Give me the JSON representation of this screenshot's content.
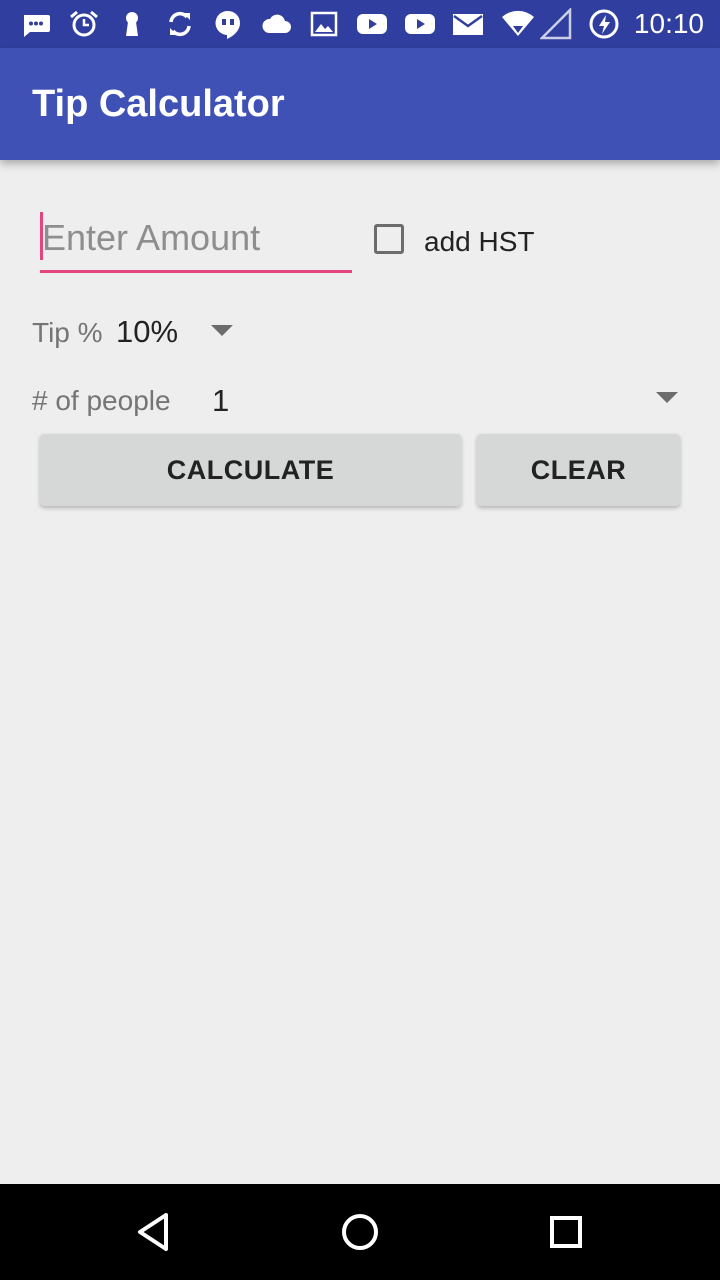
{
  "status_bar": {
    "time": "10:10",
    "icons": [
      "chat-bubble-icon",
      "alarm-clock-icon",
      "keyhole-icon",
      "sync-icon",
      "hangouts-icon",
      "cloud-icon",
      "image-icon",
      "youtube-icon",
      "youtube-icon",
      "mail-icon",
      "wifi-icon",
      "signal-icon",
      "battery-charging-icon"
    ]
  },
  "app_bar": {
    "title": "Tip Calculator"
  },
  "amount_input": {
    "value": "",
    "placeholder": "Enter Amount"
  },
  "hst_checkbox": {
    "label": "add HST",
    "checked": false
  },
  "tip": {
    "label": "Tip %",
    "selected": "10%"
  },
  "people": {
    "label": "# of people",
    "selected": "1"
  },
  "buttons": {
    "calculate": "CALCULATE",
    "clear": "CLEAR"
  },
  "colors": {
    "status_bar": "#303f9f",
    "app_bar": "#3f51b5",
    "accent": "#e5457e",
    "background": "#eeeeee",
    "button": "#d6d7d7"
  },
  "nav_bar": {
    "icons": [
      "back-icon",
      "home-icon",
      "recents-icon"
    ]
  }
}
